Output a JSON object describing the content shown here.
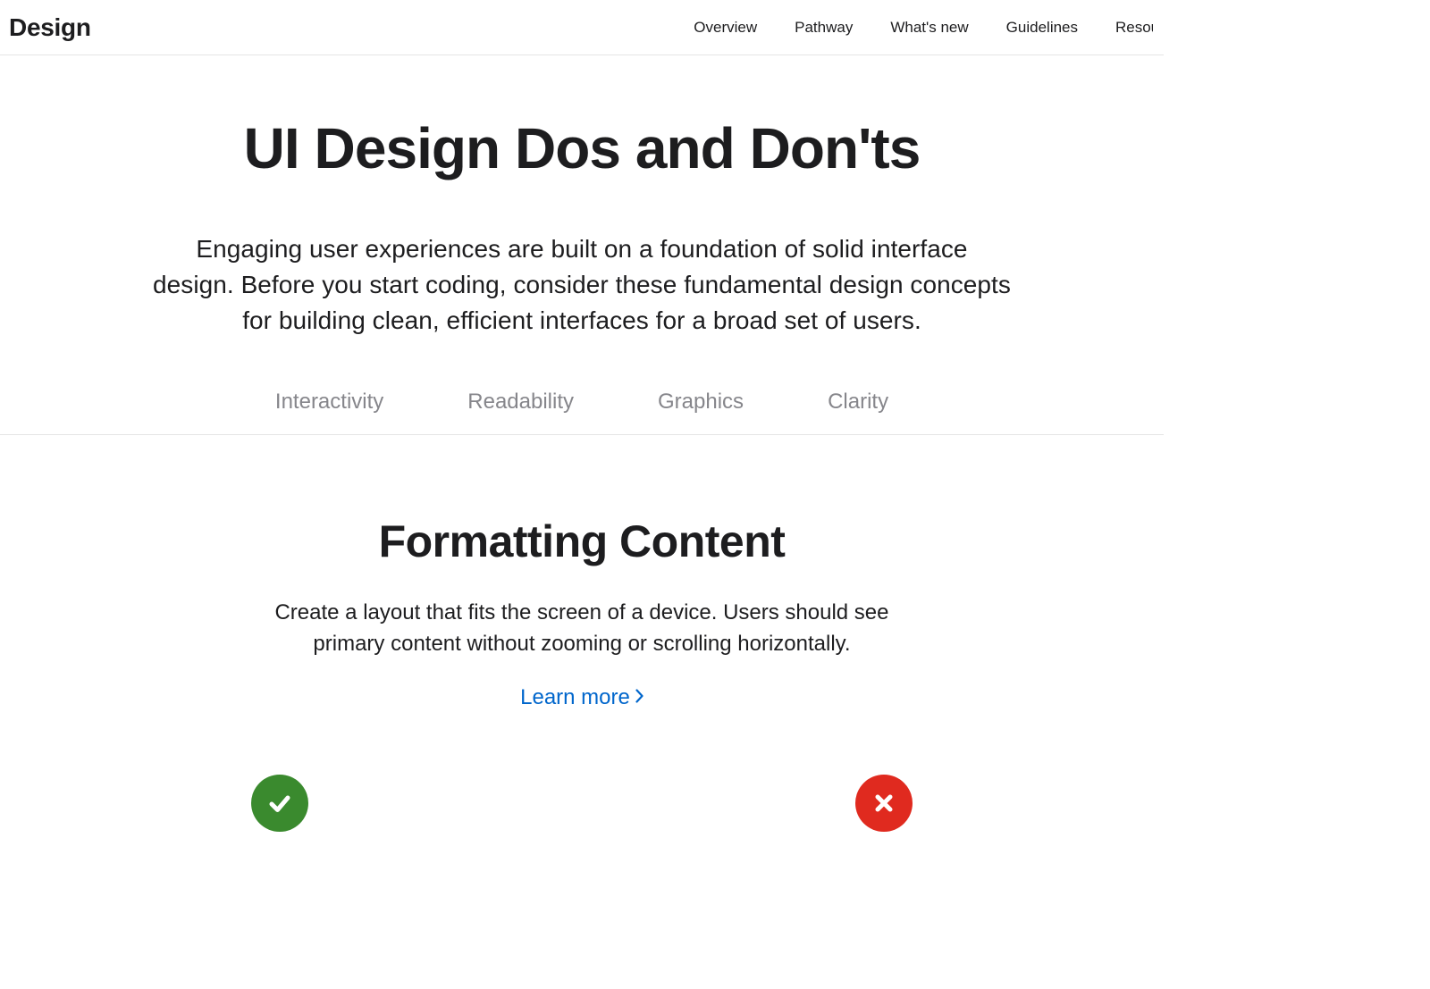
{
  "header": {
    "brand": "Design",
    "nav": [
      "Overview",
      "Pathway",
      "What's new",
      "Guidelines",
      "Resources"
    ]
  },
  "hero": {
    "title": "UI Design Dos and Don'ts",
    "lead": "Engaging user experiences are built on a foundation of solid interface design. Before you start coding, consider these fundamental design concepts for building clean, efficient interfaces for a broad set of users."
  },
  "tabs": [
    "Interactivity",
    "Readability",
    "Graphics",
    "Clarity"
  ],
  "section": {
    "title": "Formatting Content",
    "body": "Create a layout that fits the screen of a device. Users should see primary content without zooming or scrolling horizontally.",
    "learn_more": "Learn more"
  }
}
